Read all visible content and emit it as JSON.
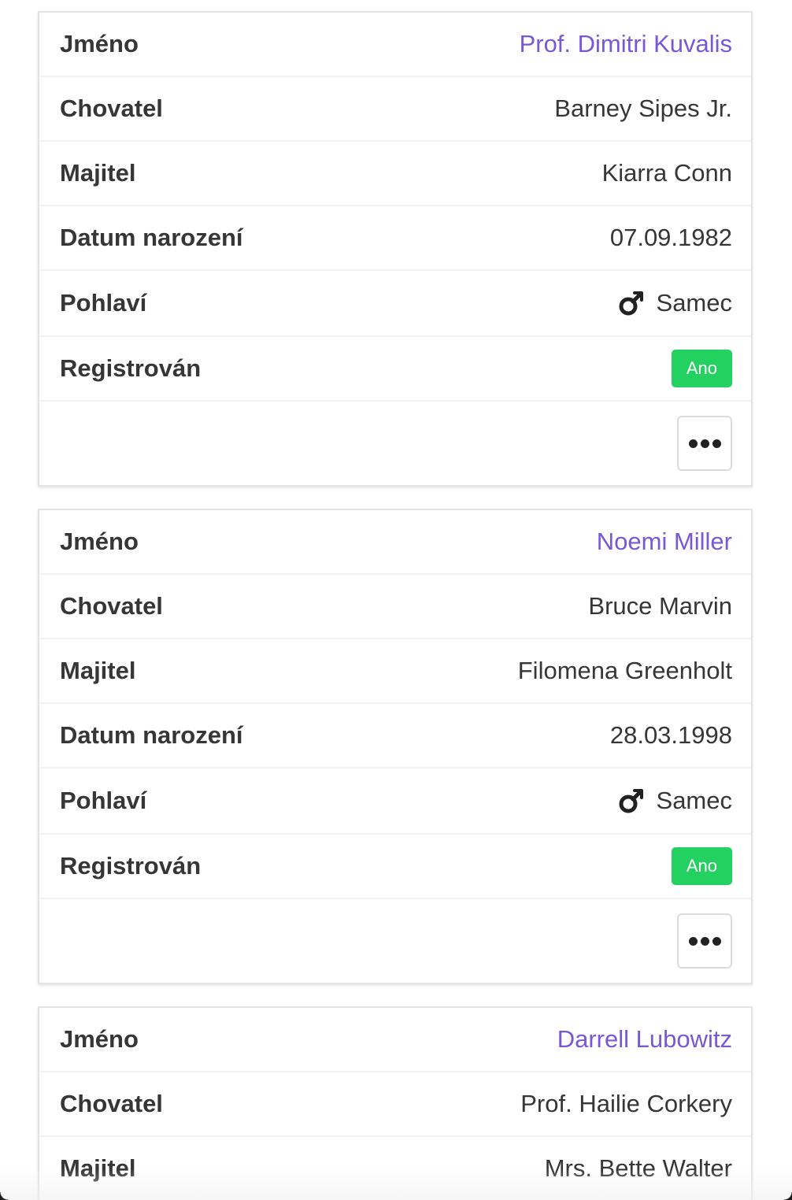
{
  "labels": {
    "name": "Jméno",
    "breeder": "Chovatel",
    "owner": "Majitel",
    "birth_date": "Datum narození",
    "sex": "Pohlaví",
    "registered": "Registrován"
  },
  "cards": [
    {
      "name": "Prof. Dimitri Kuvalis",
      "breeder": "Barney Sipes Jr.",
      "owner": "Kiarra Conn",
      "birth_date": "07.09.1982",
      "sex": "Samec",
      "sex_icon": "male-icon",
      "registered": "Ano",
      "more_icon": "ellipsis-icon"
    },
    {
      "name": "Noemi Miller",
      "breeder": "Bruce Marvin",
      "owner": "Filomena Greenholt",
      "birth_date": "28.03.1998",
      "sex": "Samec",
      "sex_icon": "male-icon",
      "registered": "Ano",
      "more_icon": "ellipsis-icon"
    },
    {
      "name": "Darrell Lubowitz",
      "breeder": "Prof. Hailie Corkery",
      "owner": "Mrs. Bette Walter"
    }
  ],
  "colors": {
    "link": "#7957d5",
    "success_badge": "#23d160",
    "text": "#363636"
  }
}
